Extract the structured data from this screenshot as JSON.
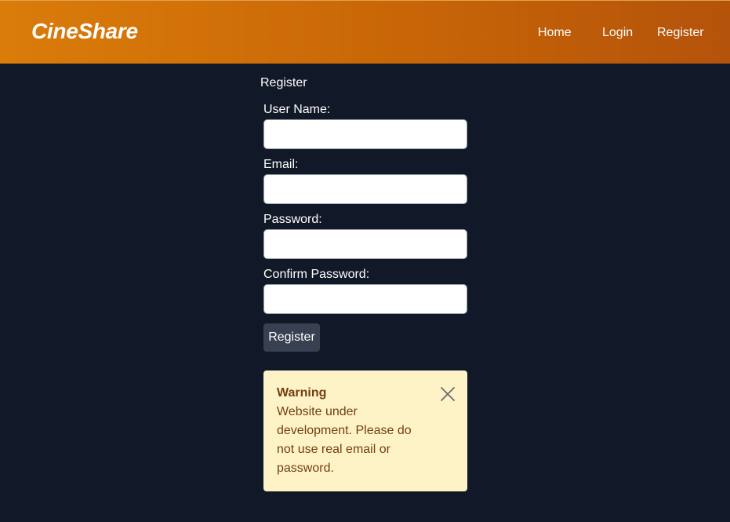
{
  "header": {
    "brand": "CineShare",
    "nav": {
      "home": "Home",
      "login": "Login",
      "register": "Register"
    }
  },
  "form": {
    "title": "Register",
    "fields": [
      {
        "label": "User Name:",
        "value": "",
        "placeholder": ""
      },
      {
        "label": "Email:",
        "value": "",
        "placeholder": ""
      },
      {
        "label": "Password:",
        "value": "",
        "placeholder": ""
      },
      {
        "label": "Confirm Password:",
        "value": "",
        "placeholder": ""
      }
    ],
    "submit_label": "Register"
  },
  "alert": {
    "title": "Warning",
    "message": "Website under development. Please do not use real email or password.",
    "close_icon": "close-icon"
  },
  "colors": {
    "header_gradient_start": "#da7c0a",
    "header_gradient_end": "#b4530a",
    "background": "#111827",
    "button": "#374151",
    "alert_background": "#fef3c7",
    "alert_text": "#713f12"
  }
}
